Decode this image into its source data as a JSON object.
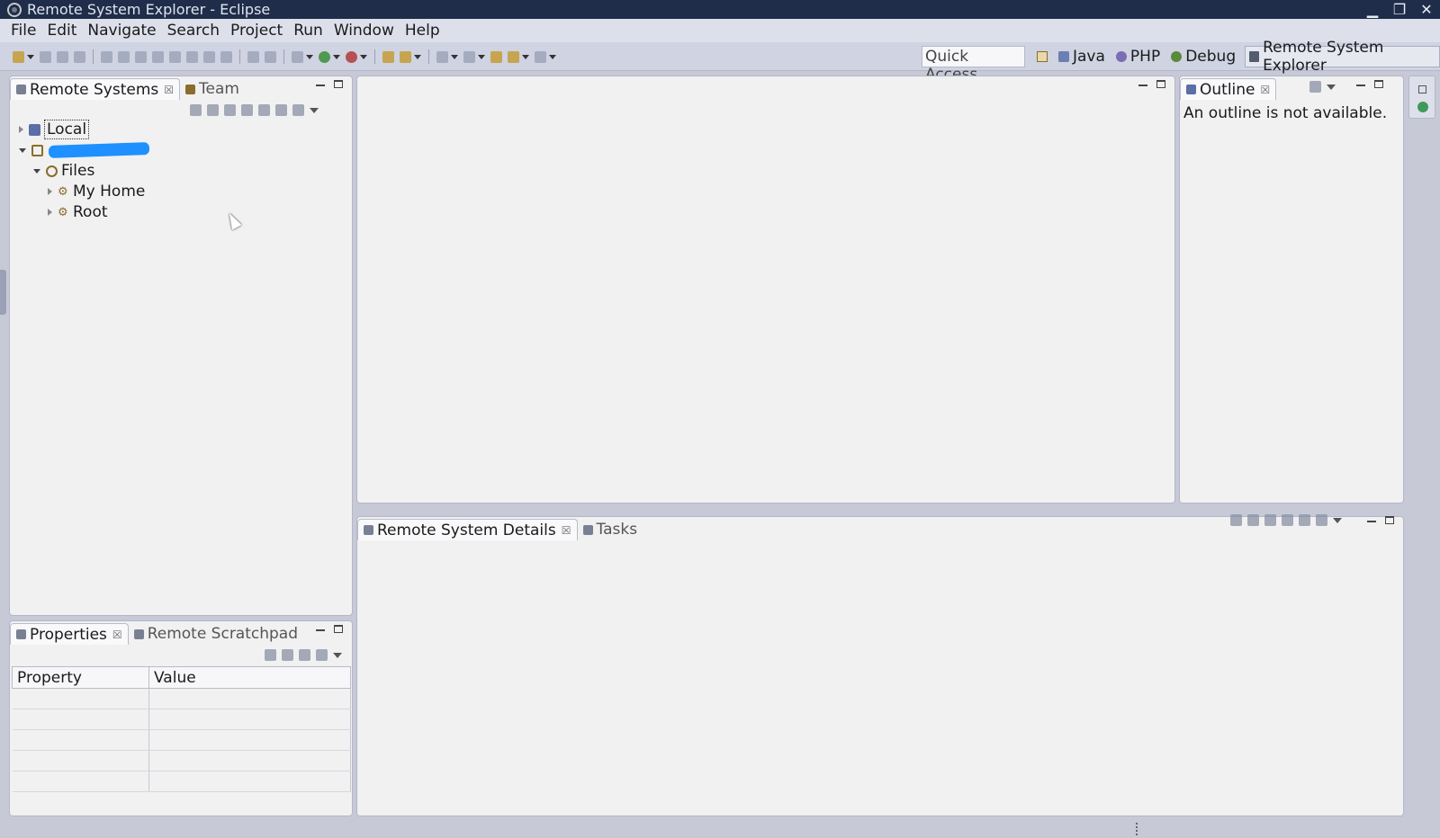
{
  "window": {
    "title": "Remote System Explorer - Eclipse"
  },
  "menu": [
    "File",
    "Edit",
    "Navigate",
    "Search",
    "Project",
    "Run",
    "Window",
    "Help"
  ],
  "toolbar": {
    "quick_access": "Quick Access",
    "perspectives": [
      "Java",
      "PHP",
      "Debug",
      "Remote System Explorer"
    ]
  },
  "remote_systems": {
    "tabs": [
      "Remote Systems",
      "Team"
    ],
    "tree": {
      "local": "Local",
      "files": "Files",
      "my_home": "My Home",
      "root": "Root"
    }
  },
  "properties": {
    "tabs": [
      "Properties",
      "Remote Scratchpad"
    ],
    "columns": [
      "Property",
      "Value"
    ]
  },
  "outline": {
    "tab": "Outline",
    "message": "An outline is not available."
  },
  "details": {
    "tabs": [
      "Remote System Details",
      "Tasks"
    ]
  },
  "colors": {
    "titlebar": "#1f2d4a",
    "workbench_bg": "#c7c9d7",
    "panel_bg": "#f1f1f1",
    "redaction": "#1e90ff"
  }
}
